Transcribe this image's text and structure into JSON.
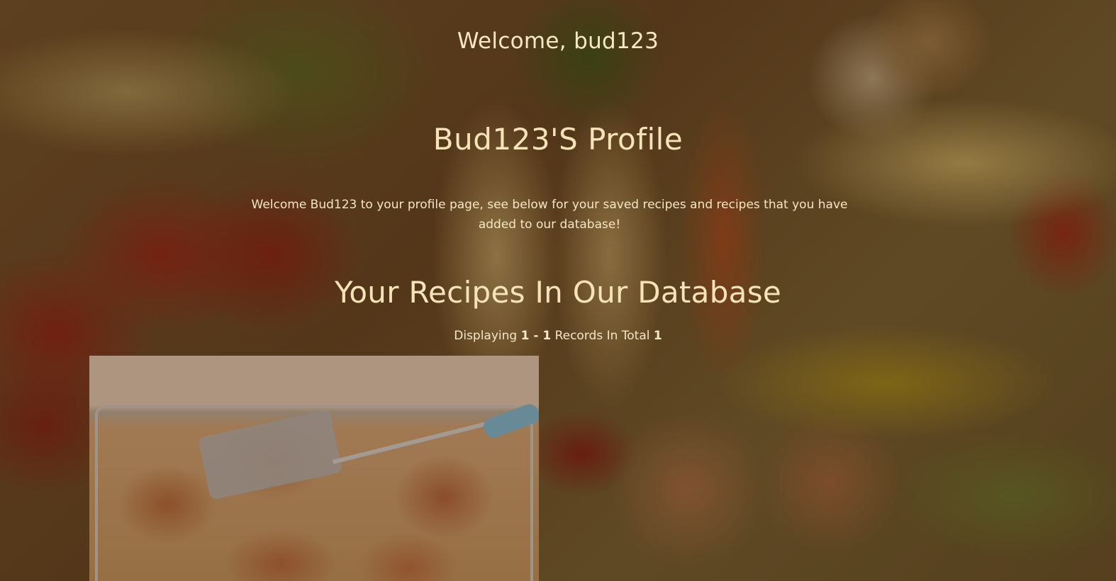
{
  "header": {
    "welcome_text": "Welcome, bud123"
  },
  "profile": {
    "title": "Bud123'S Profile",
    "intro": "Welcome Bud123 to your profile page, see below for your saved recipes and recipes that you have added to our database!"
  },
  "recipes_section": {
    "title": "Your Recipes In Our Database",
    "records": {
      "prefix": "Displaying",
      "range": "1 - 1",
      "middle": "Records In Total",
      "total": "1"
    },
    "items": [
      {
        "image": "roast-chicken-traybake-photo"
      }
    ]
  },
  "colors": {
    "text": "#f6e3b7",
    "overlay": "rgba(52, 28, 14, 0.42)"
  }
}
